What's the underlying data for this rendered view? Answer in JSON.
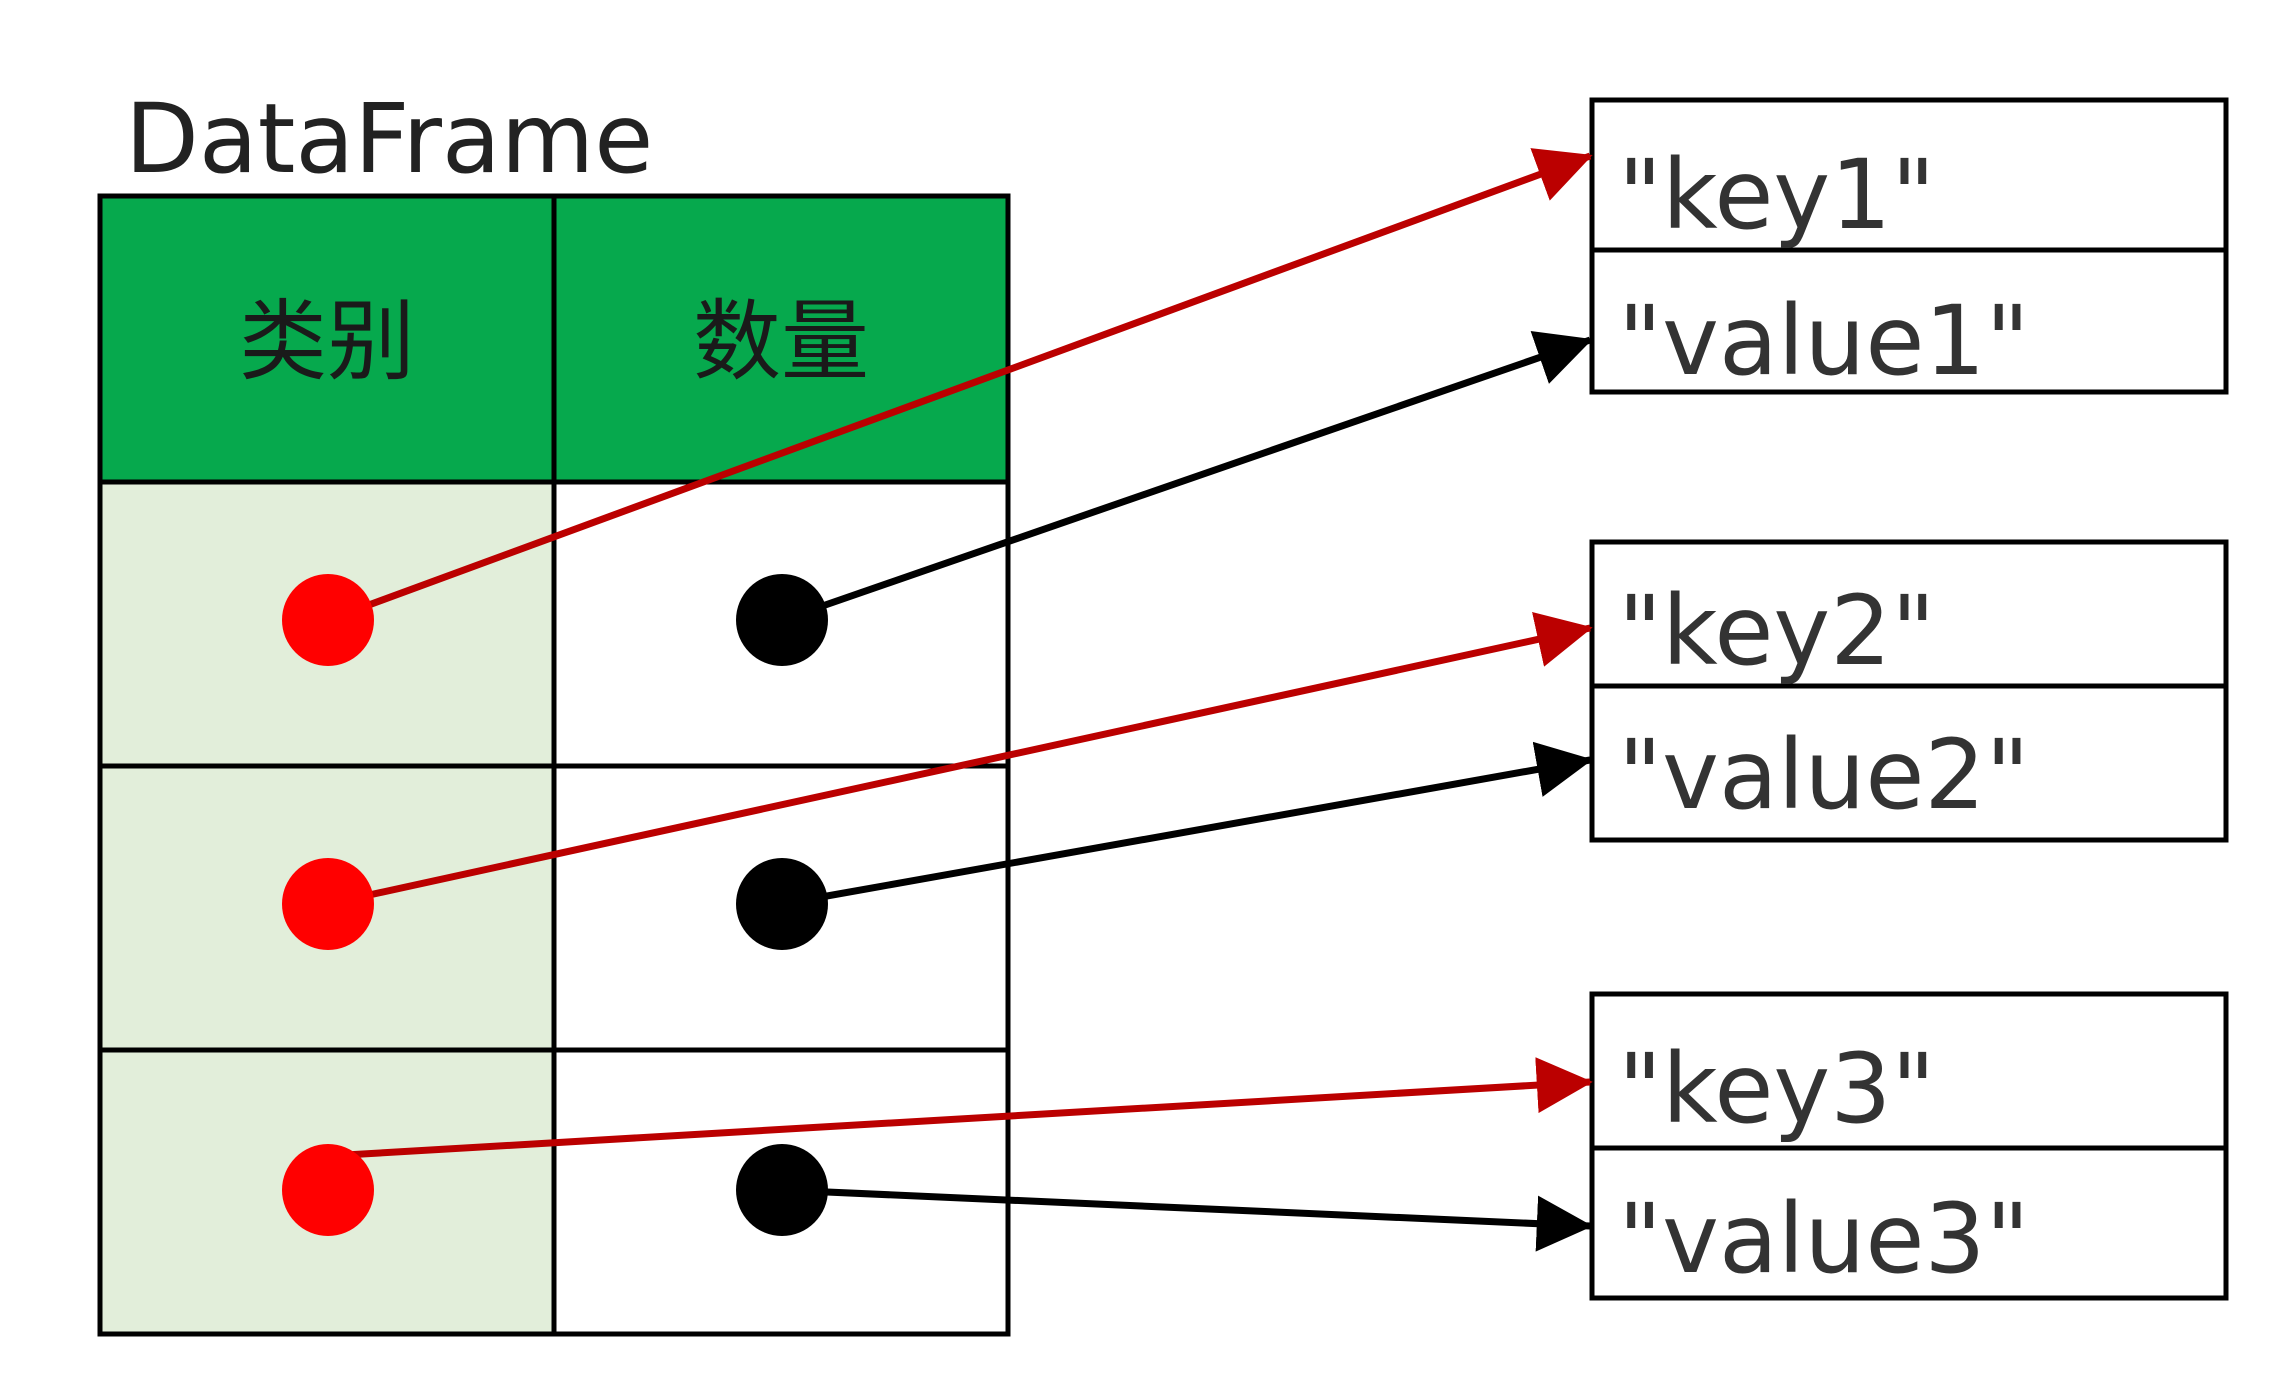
{
  "title": "DataFrame",
  "headers": [
    "类别",
    "数量"
  ],
  "rows": 3,
  "boxes": [
    {
      "key": "\"key1\"",
      "value": "\"value1\""
    },
    {
      "key": "\"key2\"",
      "value": "\"value2\""
    },
    {
      "key": "\"key3\"",
      "value": "\"value3\""
    }
  ],
  "colors": {
    "header_fill": "#06A94D",
    "category_fill": "#E2EEDA",
    "value_fill": "#FFFFFF",
    "key_arrow": "#BB0000",
    "value_arrow": "#000000",
    "key_dot": "#FF0000",
    "value_dot": "#000000"
  }
}
